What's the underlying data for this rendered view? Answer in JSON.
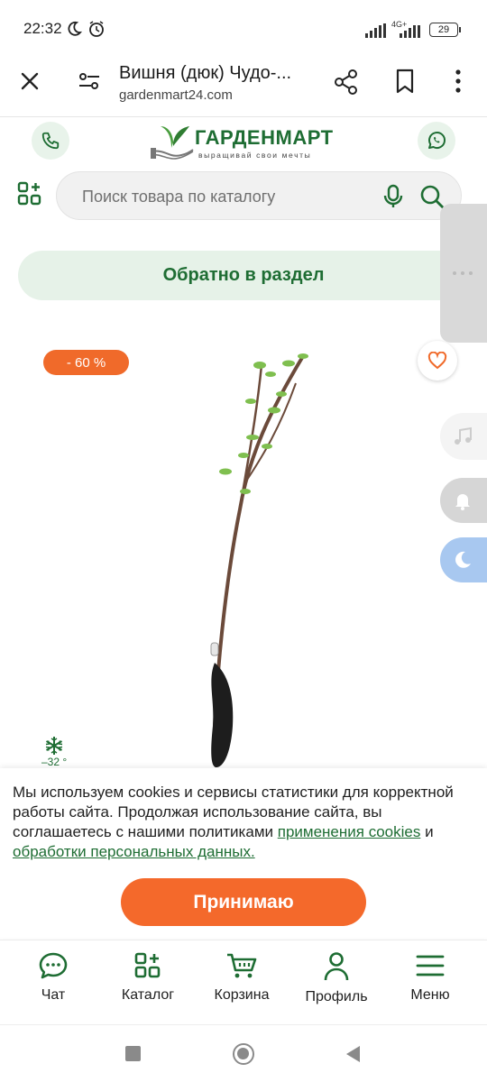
{
  "status_bar": {
    "time": "22:32",
    "network": "4G+",
    "battery": "29",
    "icons": [
      "moon-icon",
      "alarm-icon",
      "signal-icon",
      "battery-icon"
    ]
  },
  "browser": {
    "title": "Вишня (дюк) Чудо-...",
    "domain": "gardenmart24.com",
    "icons": [
      "close-icon",
      "site-settings-icon",
      "share-icon",
      "bookmark-icon",
      "more-icon"
    ]
  },
  "site": {
    "logo_text": "ГАРДЕНМАРТ",
    "logo_slogan": "выращивай свои мечты",
    "search": {
      "placeholder": "Поиск товара по каталогу"
    },
    "back_label": "Обратно в раздел"
  },
  "product": {
    "discount": "- 60 %",
    "frost_label": "–32 °"
  },
  "cookie": {
    "text": "Мы используем cookies и сервисы статистики для корректной работы сайта. Продолжая использование сайта, вы соглашаетесь с нашими политиками",
    "link1": "применения cookies",
    "and": "и",
    "link2": "обработки персональных данных.",
    "accept": "Принимаю"
  },
  "nav": [
    {
      "label": "Чат",
      "icon": "chat-icon"
    },
    {
      "label": "Каталог",
      "icon": "catalog-icon"
    },
    {
      "label": "Корзина",
      "icon": "cart-icon"
    },
    {
      "label": "Профиль",
      "icon": "profile-icon"
    },
    {
      "label": "Меню",
      "icon": "menu-icon"
    }
  ],
  "colors": {
    "brand_green": "#1e6d33",
    "accent_orange": "#f06a2a",
    "pill_green_bg": "#e6f2e8"
  }
}
